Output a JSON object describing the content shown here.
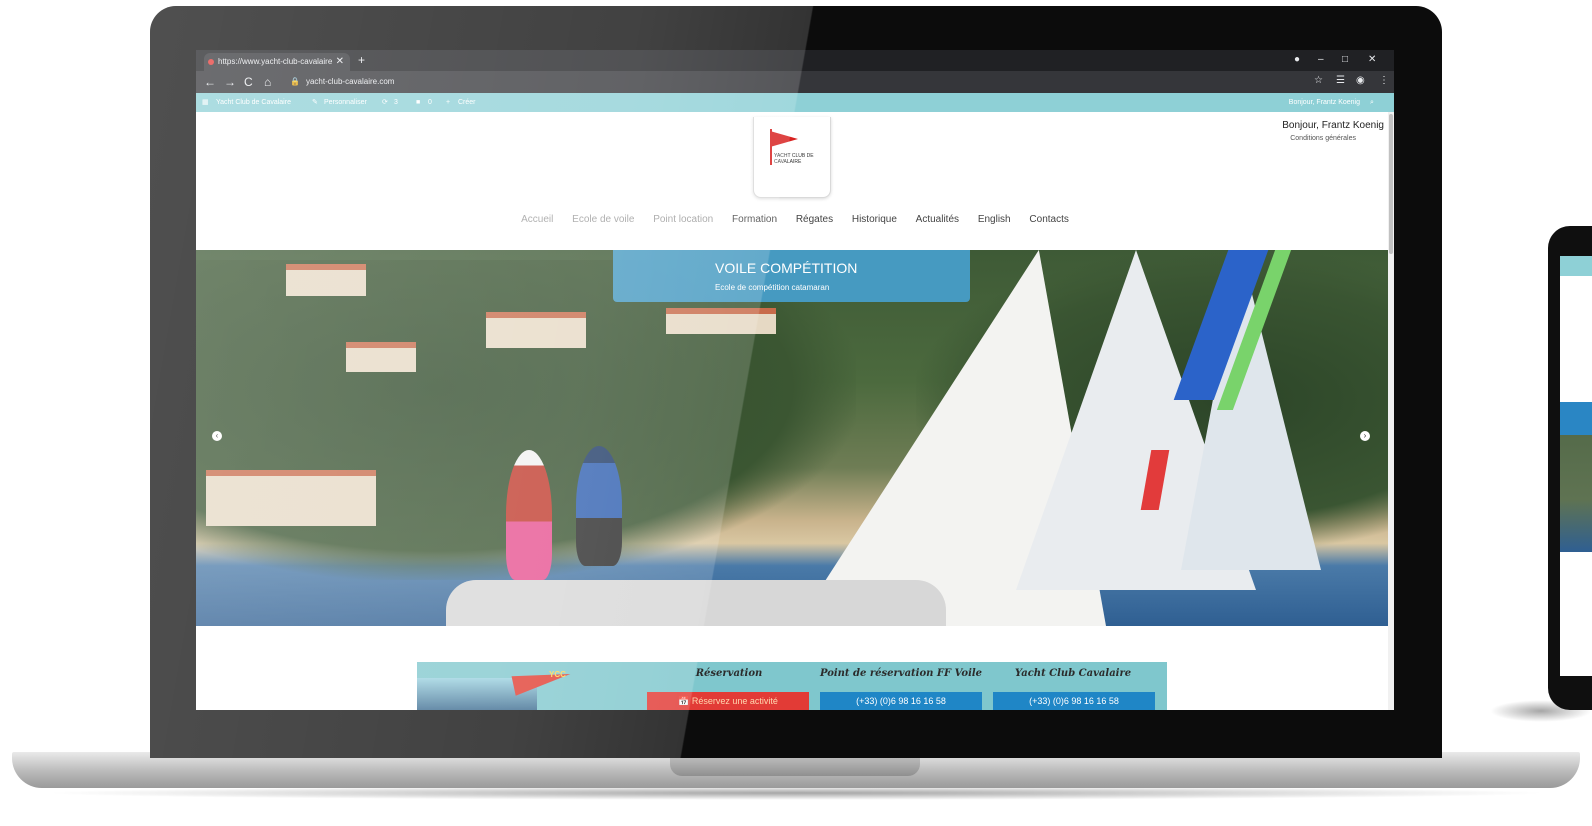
{
  "browser": {
    "tab_title": "https://www.yacht-club-cavalaire",
    "new_tab": "+",
    "url": "yacht-club-cavalaire.com",
    "window_controls": [
      "●",
      "–",
      "□",
      "✕"
    ]
  },
  "admin_bar": {
    "site_name": "Yacht Club de Cavalaire",
    "customize": "Personnaliser",
    "updates": "3",
    "comments": "0",
    "new": "Créer",
    "greeting": "Bonjour, Frantz Koenig"
  },
  "header": {
    "logo_text": "YACHT CLUB DE CAVALAIRE",
    "greeting": "Bonjour, Frantz Koenig",
    "conditions_link": "Conditions générales"
  },
  "menu": [
    {
      "label": "Accueil"
    },
    {
      "label": "Ecole de voile"
    },
    {
      "label": "Point location"
    },
    {
      "label": "Formation"
    },
    {
      "label": "Régates"
    },
    {
      "label": "Historique"
    },
    {
      "label": "Actualités"
    },
    {
      "label": "English"
    },
    {
      "label": "Contacts"
    }
  ],
  "hero": {
    "title": "VOILE COMPÉTITION",
    "subtitle": "Ecole de compétition catamaran"
  },
  "footer_strip": {
    "logo_text": "YCC",
    "columns": [
      {
        "title": "Réservation",
        "button": "Réservez une activité"
      },
      {
        "title": "Point de réservation FF Voile",
        "button": "(+33) (0)6 98 16 16 58"
      },
      {
        "title": "Yacht Club Cavalaire",
        "button": "(+33) (0)6 98 16 16 58"
      }
    ]
  },
  "colors": {
    "admin_bar": "#8ed0d6",
    "caption_bg": "#47a0cd",
    "reserve_button": "#e23b36",
    "phone_button": "#1f86c6"
  },
  "icons": {
    "back": "←",
    "forward": "→",
    "reload": "C",
    "home": "⌂",
    "star": "☆",
    "menu": "⋮",
    "arrow_left": "‹",
    "arrow_right": "›"
  }
}
